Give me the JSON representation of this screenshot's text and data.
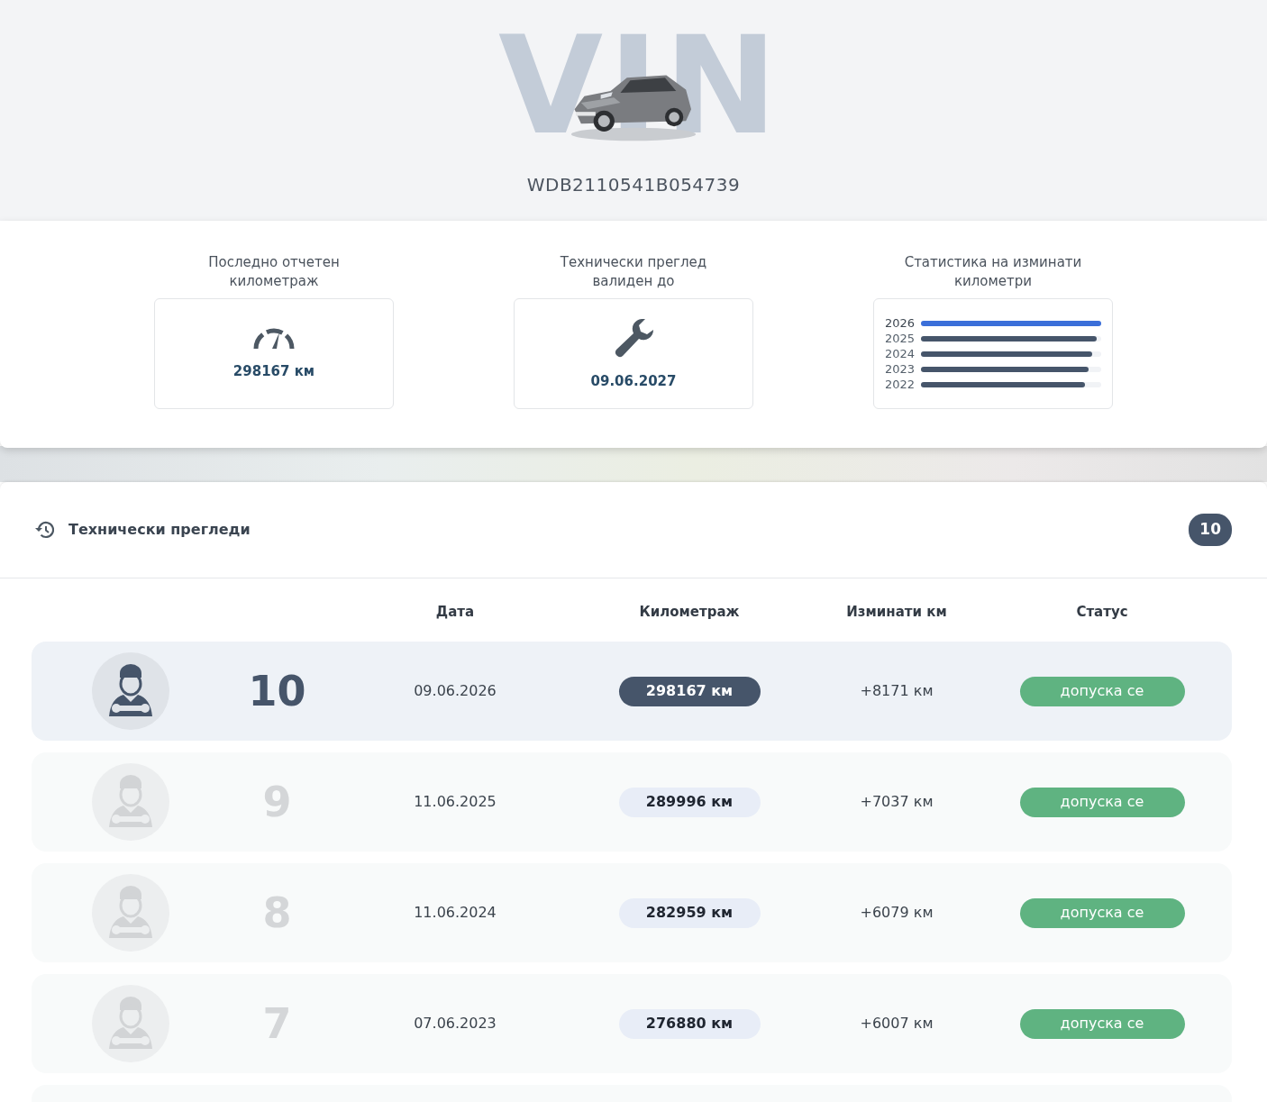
{
  "hero": {
    "backdrop_text": "VIN",
    "vin": "WDB2110541B054739"
  },
  "summary": [
    {
      "kind": "mileage",
      "title": "Последно отчетен километраж",
      "value": "298167 км"
    },
    {
      "kind": "inspection",
      "title": "Технически преглед валиден до",
      "value": "09.06.2027"
    },
    {
      "kind": "stats",
      "title": "Статистика на изминати километри",
      "bars": [
        {
          "label": "2026",
          "level": 1,
          "selected": true
        },
        {
          "label": "2025",
          "level": 0.975,
          "selected": false
        },
        {
          "label": "2024",
          "level": 0.95,
          "selected": false
        },
        {
          "label": "2023",
          "level": 0.93,
          "selected": false
        },
        {
          "label": "2022",
          "level": 0.91,
          "selected": false
        }
      ]
    }
  ],
  "inspections": {
    "title": "Технически прегледи",
    "count": "10",
    "columns": [
      "Дата",
      "Километраж",
      "Изминати км",
      "Статус"
    ],
    "rows": [
      {
        "number": "10",
        "date": "09.06.2026",
        "mileage": "298167 км",
        "change": "+8171 км",
        "status": "допуска се",
        "selected": true
      },
      {
        "number": "9",
        "date": "11.06.2025",
        "mileage": "289996 км",
        "change": "+7037 км",
        "status": "допуска се",
        "selected": false
      },
      {
        "number": "8",
        "date": "11.06.2024",
        "mileage": "282959 км",
        "change": "+6079 км",
        "status": "допуска се",
        "selected": false
      },
      {
        "number": "7",
        "date": "07.06.2023",
        "mileage": "276880 км",
        "change": "+6007 км",
        "status": "допуска се",
        "selected": false
      }
    ]
  }
}
